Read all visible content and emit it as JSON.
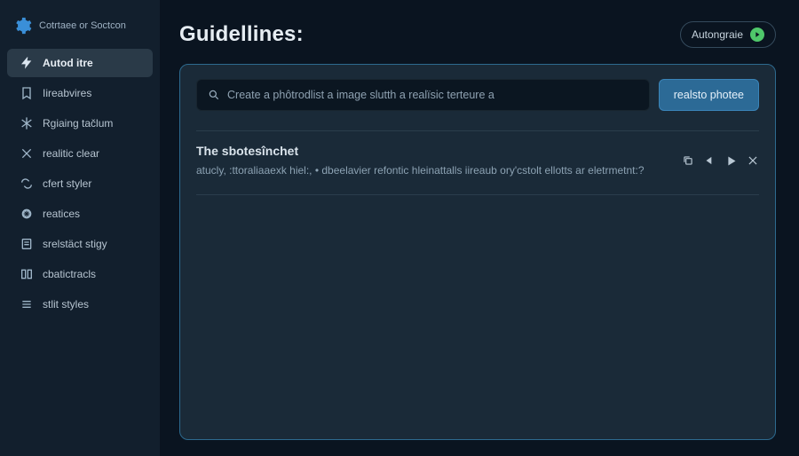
{
  "brand": {
    "name": "Cotrtaee or Soctcon"
  },
  "sidebar": {
    "items": [
      {
        "label": "Autod itre"
      },
      {
        "label": "Iireabvires"
      },
      {
        "label": "Rgiaing tačlum"
      },
      {
        "label": "realitic clear"
      },
      {
        "label": "cfert styler"
      },
      {
        "label": "reatices"
      },
      {
        "label": "srelstäct stigy"
      },
      {
        "label": "cbatictracls"
      },
      {
        "label": "stlit styles"
      }
    ]
  },
  "header": {
    "title": "Guidellines:",
    "autogen_label": "Autongraie"
  },
  "search": {
    "placeholder": "Create a phôtrodlist a image slutth a realïsic terteure a",
    "button_label": "realsto photee"
  },
  "result": {
    "title": "The sbotesînchet",
    "description": "atucly, :ttoraliaaexk hiel:, • dbeelavier refontic hleinattalls iireaub ory'cstolt ellotts ar eletrmetnt:?"
  }
}
